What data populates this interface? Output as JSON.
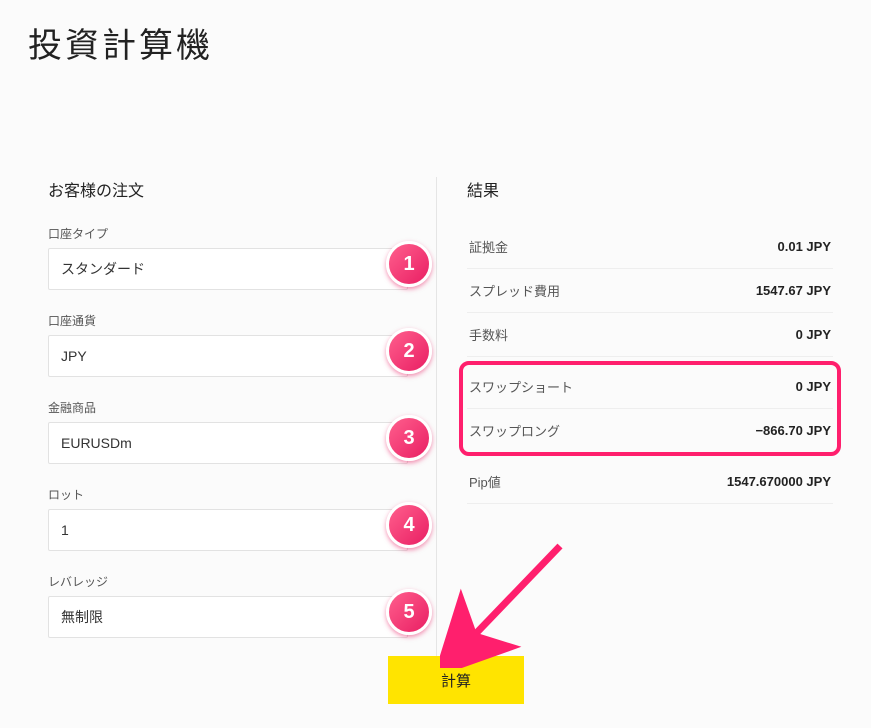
{
  "title": "投資計算機",
  "form": {
    "heading": "お客様の注文",
    "fields": [
      {
        "label": "口座タイプ",
        "value": "スタンダード",
        "badge": "1"
      },
      {
        "label": "口座通貨",
        "value": "JPY",
        "badge": "2"
      },
      {
        "label": "金融商品",
        "value": "EURUSDm",
        "badge": "3"
      },
      {
        "label": "ロット",
        "value": "1",
        "badge": "4"
      },
      {
        "label": "レバレッジ",
        "value": "無制限",
        "badge": "5"
      }
    ]
  },
  "results": {
    "heading": "結果",
    "rows_top": [
      {
        "label": "証拠金",
        "value": "0.01 JPY"
      },
      {
        "label": "スプレッド費用",
        "value": "1547.67 JPY"
      },
      {
        "label": "手数料",
        "value": "0 JPY"
      }
    ],
    "rows_highlight": [
      {
        "label": "スワップショート",
        "value": "0 JPY"
      },
      {
        "label": "スワップロング",
        "value": "−866.70 JPY"
      }
    ],
    "rows_bottom": [
      {
        "label": "Pip値",
        "value": "1547.670000 JPY"
      }
    ]
  },
  "action": {
    "calculate": "計算"
  }
}
